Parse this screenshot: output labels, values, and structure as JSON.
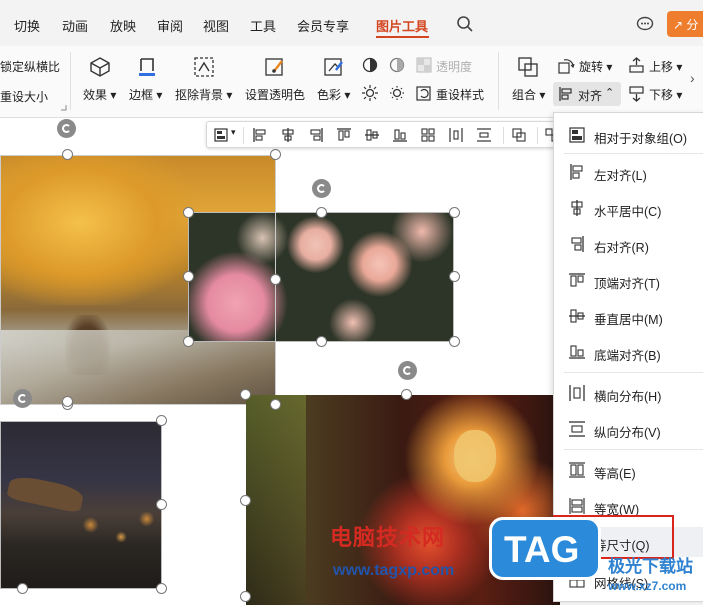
{
  "menubar": {
    "items": [
      "切换",
      "动画",
      "放映",
      "审阅",
      "视图",
      "工具",
      "会员专享",
      "图片工具"
    ],
    "active": "图片工具",
    "share_label": "分"
  },
  "ribbon": {
    "lock_ratio": "锁定纵横比",
    "reset_size": "重设大小",
    "effect": "效果",
    "border": "边框",
    "remove_bg": "抠除背景",
    "set_transparent": "设置透明色",
    "color": "色彩",
    "transparency": "透明度",
    "reset_style": "重设样式",
    "group": "组合",
    "rotate": "旋转",
    "align": "对齐",
    "move_up": "上移",
    "move_down": "下移"
  },
  "dropdown": {
    "items": [
      {
        "label": "相对于对象组(O)",
        "icon": "align-relative-icon"
      },
      {
        "label": "左对齐(L)",
        "icon": "align-left-icon"
      },
      {
        "label": "水平居中(C)",
        "icon": "align-center-h-icon"
      },
      {
        "label": "右对齐(R)",
        "icon": "align-right-icon"
      },
      {
        "label": "顶端对齐(T)",
        "icon": "align-top-icon"
      },
      {
        "label": "垂直居中(M)",
        "icon": "align-middle-v-icon"
      },
      {
        "label": "底端对齐(B)",
        "icon": "align-bottom-icon"
      },
      {
        "label": "横向分布(H)",
        "icon": "distribute-h-icon"
      },
      {
        "label": "纵向分布(V)",
        "icon": "distribute-v-icon"
      },
      {
        "label": "等高(E)",
        "icon": "same-height-icon"
      },
      {
        "label": "等宽(W)",
        "icon": "same-width-icon"
      },
      {
        "label": "等尺寸(Q)",
        "icon": "same-size-icon"
      },
      {
        "label": "网格线(S)",
        "icon": "gridline-icon"
      }
    ],
    "highlighted": "等尺寸(Q)"
  },
  "watermark": {
    "cn_text": "电脑技术网",
    "url": "www.tagxp.com",
    "tag": "TAG",
    "xz_text": "极光下载站",
    "xz_url": "www.xz7.com"
  },
  "colors": {
    "accent": "#d4461f",
    "highlight_box": "#d9261c",
    "tag_blue": "#2b8ad9"
  }
}
